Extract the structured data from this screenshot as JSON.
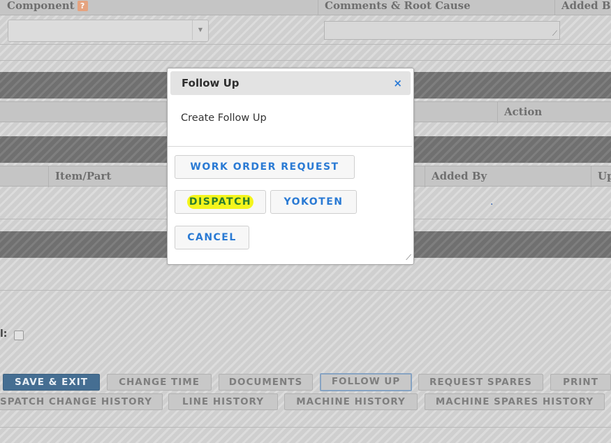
{
  "table1": {
    "headers": [
      "Component",
      "Comments & Root Cause",
      "Added B"
    ]
  },
  "table2": {
    "headers": [
      "Action"
    ]
  },
  "table3": {
    "headers": [
      "Item/Part",
      "Added By",
      "Up"
    ],
    "cell_dot": "."
  },
  "field_label": "l:",
  "modal": {
    "title": "Follow Up",
    "close_glyph": "×",
    "body_text": "Create Follow Up",
    "buttons": {
      "work_order_request": "WORK ORDER REQUEST",
      "dispatch": "DISPATCH",
      "yokoten": "YOKOTEN",
      "cancel": "CANCEL"
    }
  },
  "actions_row1": [
    "SAVE & EXIT",
    "CHANGE TIME",
    "DOCUMENTS",
    "FOLLOW UP",
    "REQUEST SPARES",
    "PRINT"
  ],
  "actions_row2": [
    "SPATCH CHANGE HISTORY",
    "LINE HISTORY",
    "MACHINE HISTORY",
    "MACHINE SPARES HISTORY"
  ],
  "colors": {
    "primary_button": "#456e92",
    "link_blue": "#2a7ad4",
    "highlight": "#f4f51c"
  },
  "icons": {
    "help": "help-icon",
    "close": "close-icon",
    "dropdown": "chevron-down-icon"
  }
}
